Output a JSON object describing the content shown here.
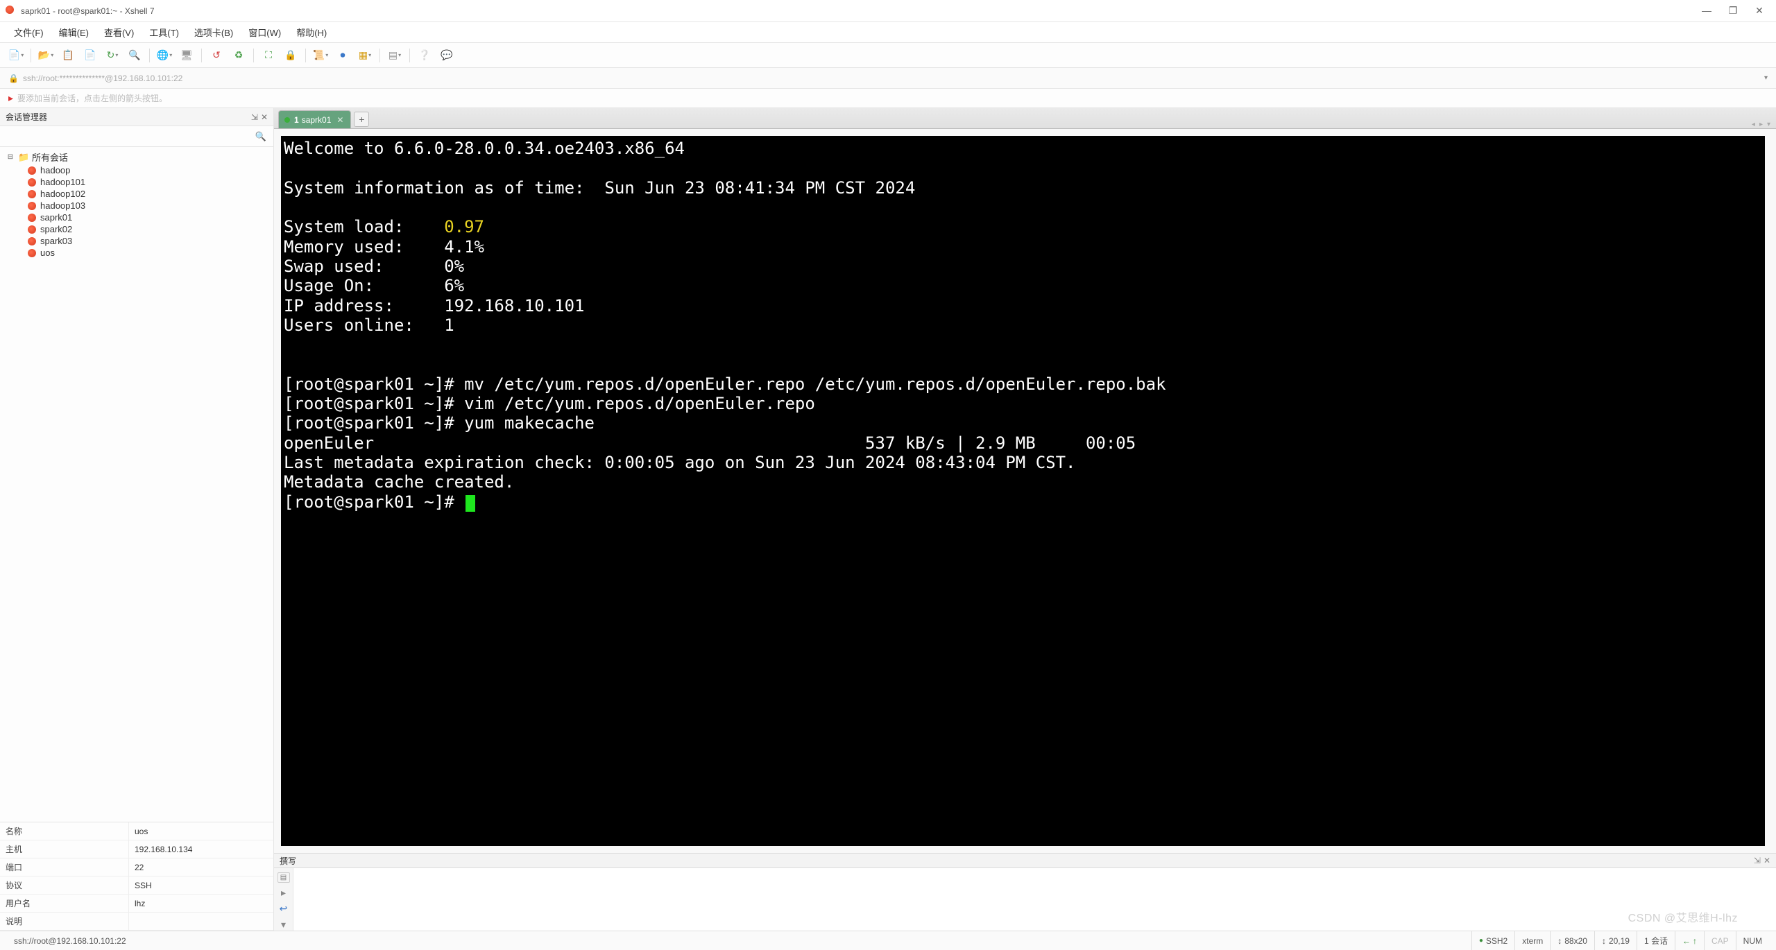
{
  "window": {
    "title": "saprk01 - root@spark01:~ - Xshell 7",
    "min_label": "—",
    "max_label": "❐",
    "close_label": "✕"
  },
  "menu": {
    "items": [
      "文件(F)",
      "编辑(E)",
      "查看(V)",
      "工具(T)",
      "选项卡(B)",
      "窗口(W)",
      "帮助(H)"
    ]
  },
  "toolbar": {
    "new_session": "新建",
    "open_session": "打开",
    "reconnect": "重连",
    "disconnect": "断开",
    "copy": "复制",
    "paste": "粘贴",
    "find": "查找",
    "globe": "网络",
    "desktop": "桌面",
    "refresh": "刷新",
    "lock": "锁定",
    "fullscreen": "全屏",
    "record": "录制",
    "colorset": "配色",
    "font": "字体",
    "cascade": "平铺",
    "help": "帮助",
    "about": "关于"
  },
  "addressbar": {
    "text": "ssh://root:**************@192.168.10.101:22"
  },
  "hint": {
    "text": "要添加当前会话，点击左侧的箭头按钮。"
  },
  "session_manager": {
    "header": "会话管理器",
    "pin_glyph": "⇲",
    "close_glyph": "✕",
    "search_placeholder": "",
    "root": "所有会话",
    "items": [
      "hadoop",
      "hadoop101",
      "hadoop102",
      "hadoop103",
      "saprk01",
      "spark02",
      "spark03",
      "uos"
    ]
  },
  "properties": {
    "rows": [
      {
        "label": "名称",
        "value": "uos"
      },
      {
        "label": "主机",
        "value": "192.168.10.134"
      },
      {
        "label": "端口",
        "value": "22"
      },
      {
        "label": "协议",
        "value": "SSH"
      },
      {
        "label": "用户名",
        "value": "lhz"
      },
      {
        "label": "说明",
        "value": ""
      }
    ]
  },
  "tabs": {
    "active": {
      "index": "1",
      "label": "saprk01"
    },
    "add_glyph": "+"
  },
  "terminal": {
    "welcome": "Welcome to 6.6.0-28.0.0.34.oe2403.x86_64",
    "sysinfo_label": "System information as of time:  ",
    "sysinfo_time": "Sun Jun 23 08:41:34 PM CST 2024",
    "load_label": "System load:    ",
    "load_value": "0.97",
    "mem_line": "Memory used:    4.1%",
    "swap_line": "Swap used:      0%",
    "usage_line": "Usage On:       6%",
    "ip_line": "IP address:     192.168.10.101",
    "users_line": "Users online:   1",
    "prompt1": "[root@spark01 ~]# mv /etc/yum.repos.d/openEuler.repo /etc/yum.repos.d/openEuler.repo.bak",
    "prompt2": "[root@spark01 ~]# vim /etc/yum.repos.d/openEuler.repo",
    "prompt3": "[root@spark01 ~]# yum makecache",
    "repo_line": "openEuler                                                 537 kB/s | 2.9 MB     00:05",
    "meta_line": "Last metadata expiration check: 0:00:05 ago on Sun 23 Jun 2024 08:43:04 PM CST.",
    "created_line": "Metadata cache created.",
    "prompt4": "[root@spark01 ~]# "
  },
  "compose": {
    "header": "撰写",
    "pin_glyph": "⇲",
    "close_glyph": "✕"
  },
  "watermark": "CSDN @艾思维H-lhz",
  "statusbar": {
    "conn": "ssh://root@192.168.10.101:22",
    "proto": "SSH2",
    "term": "xterm",
    "size_icon": "↕",
    "size": "88x20",
    "pos_icon": "↕",
    "pos": "20,19",
    "sess": "1 会话",
    "rec_icon": "←",
    "rec": "↑",
    "caps": "CAP",
    "num": "NUM"
  }
}
